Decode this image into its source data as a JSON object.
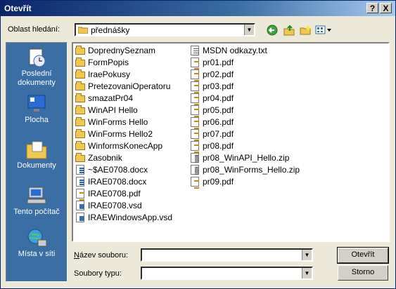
{
  "window": {
    "title": "Otevřít",
    "help_button": "?",
    "close_button": "X"
  },
  "lookin": {
    "label": "Oblast hledání:",
    "value": "přednášky"
  },
  "toolbar": {
    "icons": [
      "back-icon",
      "up-folder-icon",
      "new-folder-icon",
      "views-menu-icon"
    ]
  },
  "places": [
    {
      "label": "Poslední dokumenty",
      "icon": "recent-documents-icon"
    },
    {
      "label": "Plocha",
      "icon": "desktop-icon"
    },
    {
      "label": "Dokumenty",
      "icon": "my-documents-icon"
    },
    {
      "label": "Tento počítač",
      "icon": "my-computer-icon"
    },
    {
      "label": "Místa v síti",
      "icon": "network-places-icon"
    }
  ],
  "files_col1": [
    {
      "name": "DoprednySeznam",
      "type": "folder"
    },
    {
      "name": "FormPopis",
      "type": "folder"
    },
    {
      "name": "IraePokusy",
      "type": "folder"
    },
    {
      "name": "PretezovaniOperatoru",
      "type": "folder"
    },
    {
      "name": "smazatPr04",
      "type": "folder"
    },
    {
      "name": "WinAPI Hello",
      "type": "folder"
    },
    {
      "name": "WinForms Hello",
      "type": "folder"
    },
    {
      "name": "WinForms Hello2",
      "type": "folder"
    },
    {
      "name": "WinformsKonecApp",
      "type": "folder"
    },
    {
      "name": "Zasobnik",
      "type": "folder"
    },
    {
      "name": "~$AE0708.docx",
      "type": "docx"
    },
    {
      "name": "IRAE0708.docx",
      "type": "docx"
    },
    {
      "name": "IRAE0708.pdf",
      "type": "pdf"
    },
    {
      "name": "IRAE0708.vsd",
      "type": "vsd"
    },
    {
      "name": "IRAEWindowsApp.vsd",
      "type": "vsd"
    }
  ],
  "files_col2": [
    {
      "name": "MSDN odkazy.txt",
      "type": "txt"
    },
    {
      "name": "pr01.pdf",
      "type": "pdf"
    },
    {
      "name": "pr02.pdf",
      "type": "pdf"
    },
    {
      "name": "pr03.pdf",
      "type": "pdf"
    },
    {
      "name": "pr04.pdf",
      "type": "pdf"
    },
    {
      "name": "pr05.pdf",
      "type": "pdf"
    },
    {
      "name": "pr06.pdf",
      "type": "pdf"
    },
    {
      "name": "pr07.pdf",
      "type": "pdf"
    },
    {
      "name": "pr08.pdf",
      "type": "pdf"
    },
    {
      "name": "pr08_WinAPI_Hello.zip",
      "type": "zip"
    },
    {
      "name": "pr08_WinForms_Hello.zip",
      "type": "zip"
    },
    {
      "name": "pr09.pdf",
      "type": "pdf"
    }
  ],
  "filename": {
    "label": "Název souboru:",
    "value": ""
  },
  "filetype": {
    "label": "Soubory typu:",
    "value": ""
  },
  "buttons": {
    "open": "Otevřít",
    "cancel": "Storno"
  }
}
